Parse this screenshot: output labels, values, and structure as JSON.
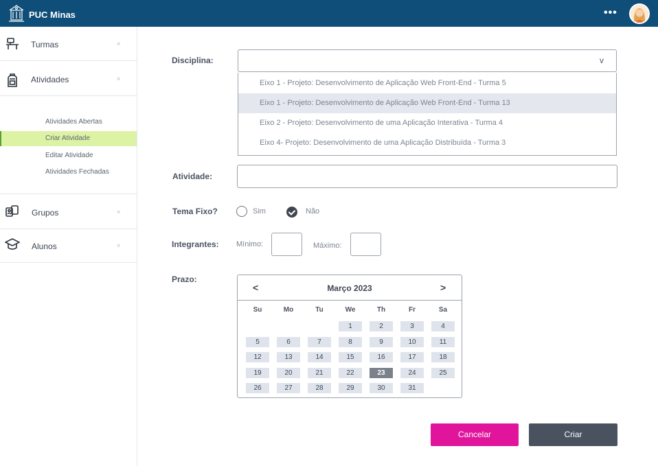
{
  "header": {
    "brand": "PUC Minas",
    "more": "•••",
    "logo_icon": "university-crest-icon",
    "avatar_icon": "user-avatar-icon"
  },
  "sidebar": {
    "turmas": {
      "label": "Turmas",
      "chevron": "˄"
    },
    "atividades": {
      "label": "Atividades",
      "chevron": "˄"
    },
    "sub_items": [
      "Atividades Abertas",
      "Criar Atividade",
      "Editar Atividade",
      "Atividades Fechadas"
    ],
    "grupos": {
      "label": "Grupos",
      "chevron": "˅"
    },
    "alunos": {
      "label": "Alunos",
      "chevron": "˅"
    }
  },
  "form": {
    "disciplina_label": "Disciplina:",
    "select_arrow": "v",
    "options": [
      "Eixo 1 - Projeto: Desenvolvimento de Aplicação Web Front-End - Turma 5",
      "Eixo 1 - Projeto: Desenvolvimento de Aplicação Web Front-End - Turma 13",
      "Eixo 2 - Projeto: Desenvolvimento de uma Aplicação Interativa - Turma 4",
      "Eixo 4- Projeto: Desenvolvimento de uma Aplicação Distribuída - Turma 3"
    ],
    "atividade_label": "Atividade:",
    "tema_label": "Tema Fixo?",
    "sim": "Sim",
    "nao": "Não",
    "integrantes_label": "Integrantes:",
    "minimo": "Mínimo:",
    "maximo": "Máximo:",
    "prazo_label": "Prazo:"
  },
  "calendar": {
    "prev": "<",
    "next": ">",
    "title": "Março 2023",
    "days_of_week": [
      "Su",
      "Mo",
      "Tu",
      "We",
      "Th",
      "Fr",
      "Sa"
    ],
    "selected_day": "23"
  },
  "buttons": {
    "cancel": "Cancelar",
    "create": "Criar"
  },
  "colors": {
    "topbar": "#0e4e78",
    "active_sub": "#dcf3a6",
    "cancel": "#e0159b",
    "create": "#4a5260"
  }
}
